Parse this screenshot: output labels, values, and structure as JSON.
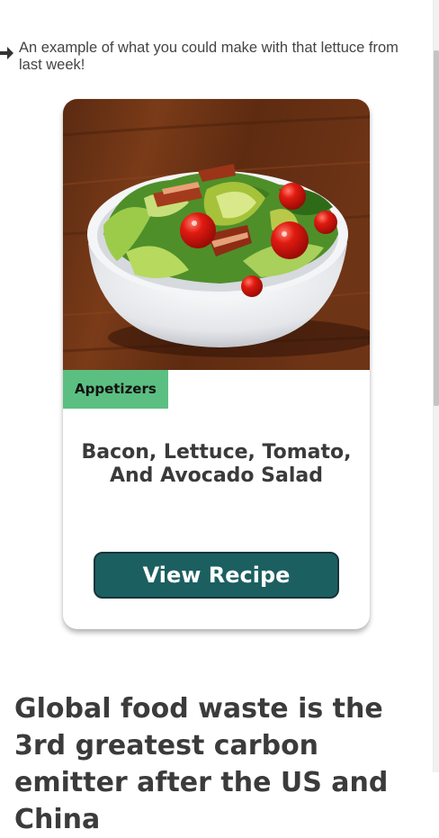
{
  "intro": {
    "icon": "arrow-right-icon",
    "text": "An example of what you could make with that lettuce from last week!"
  },
  "card": {
    "image": "salad-bowl-image",
    "category": "Appetizers",
    "title": "Bacon, Lettuce, Tomato, And Avocado Salad",
    "button_label": "View Recipe"
  },
  "section": {
    "heading": "Global food waste is the 3rd greatest carbon emitter after the US and China"
  },
  "colors": {
    "badge": "#5cbf82",
    "button": "#1c5f61",
    "button_border": "#17353a",
    "text": "#3b3b3b"
  }
}
